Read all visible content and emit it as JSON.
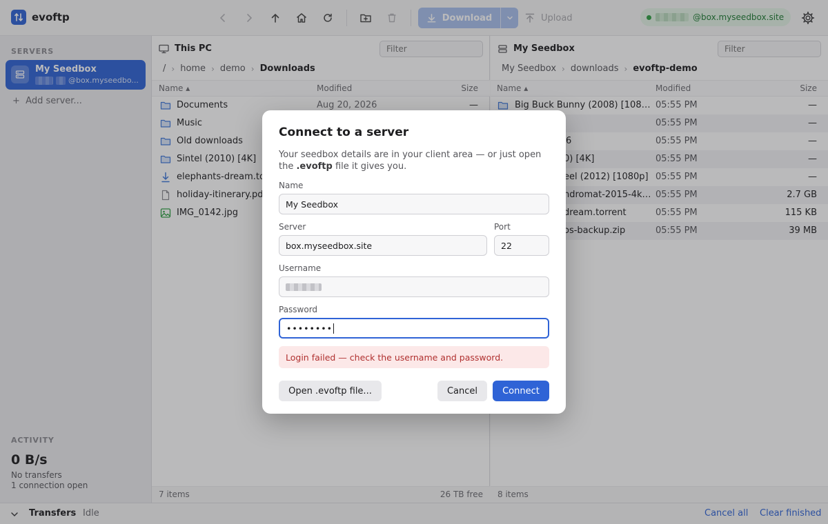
{
  "app": {
    "name": "evoftp"
  },
  "toolbar": {
    "download_label": "Download",
    "upload_label": "Upload",
    "connection_host": "@box.myseedbox.site",
    "connection_status_color": "#2ea043"
  },
  "sidebar": {
    "servers_title": "SERVERS",
    "server": {
      "name": "My Seedbox",
      "host": "@box.myseedbo..."
    },
    "add_server": "Add server...",
    "activity_title": "ACTIVITY",
    "speed": "0 B/s",
    "transfers_status": "No transfers",
    "connections": "1 connection open"
  },
  "local": {
    "title": "This PC",
    "filter_placeholder": "Filter",
    "crumbs": [
      "/",
      "home",
      "demo",
      "Downloads"
    ],
    "columns": {
      "name": "Name ▴",
      "modified": "Modified",
      "size": "Size"
    },
    "rows": [
      {
        "icon": "folder-icon",
        "name": "Documents",
        "modified": "Aug 20, 2026",
        "size": "—"
      },
      {
        "icon": "folder-icon",
        "name": "Music",
        "modified": "",
        "size": ""
      },
      {
        "icon": "folder-icon",
        "name": "Old downloads",
        "modified": "",
        "size": ""
      },
      {
        "icon": "folder-icon",
        "name": "Sintel (2010) [4K]",
        "modified": "",
        "size": ""
      },
      {
        "icon": "torrent-download-icon",
        "name": "elephants-dream.to",
        "modified": "",
        "size": ""
      },
      {
        "icon": "document-icon",
        "name": "holiday-itinerary.pd",
        "modified": "",
        "size": ""
      },
      {
        "icon": "image-icon",
        "name": "IMG_0142.jpg",
        "modified": "",
        "size": ""
      }
    ],
    "status_items": "7 items",
    "status_free": "26 TB free"
  },
  "remote": {
    "title": "My Seedbox",
    "filter_placeholder": "Filter",
    "crumbs": [
      "My Seedbox",
      "downloads",
      "evoftp-demo"
    ],
    "columns": {
      "name": "Name ▴",
      "modified": "Modified",
      "size": "Size"
    },
    "rows": [
      {
        "name": "Big Buck Bunny (2008) [108…",
        "modified": "05:55 PM",
        "size": "—"
      },
      {
        "name": "",
        "modified": "05:55 PM",
        "size": "—"
      },
      {
        "name": "6",
        "modified": "05:55 PM",
        "size": "—"
      },
      {
        "name": "0) [4K]",
        "modified": "05:55 PM",
        "size": "—"
      },
      {
        "name": "eel (2012) [1080p]",
        "modified": "05:55 PM",
        "size": "—"
      },
      {
        "name": "ndromat-2015-4k…",
        "modified": "05:55 PM",
        "size": "2.7 GB"
      },
      {
        "name": "dream.torrent",
        "modified": "05:55 PM",
        "size": "115 KB"
      },
      {
        "name": "os-backup.zip",
        "modified": "05:55 PM",
        "size": "39 MB"
      }
    ],
    "status_items": "8 items"
  },
  "transfers": {
    "title": "Transfers",
    "state": "Idle",
    "cancel_all": "Cancel all",
    "clear_finished": "Clear finished"
  },
  "dialog": {
    "title": "Connect to a server",
    "desc_before": "Your seedbox details are in your client area — or just open the ",
    "desc_file": ".evoftp",
    "desc_after": " file it gives you.",
    "name_label": "Name",
    "name_value": "My Seedbox",
    "server_label": "Server",
    "server_value": "box.myseedbox.site",
    "port_label": "Port",
    "port_value": "22",
    "username_label": "Username",
    "password_label": "Password",
    "password_value": "••••••••",
    "error": "Login failed — check the username and password.",
    "open_file_button": "Open .evoftp file...",
    "cancel_button": "Cancel",
    "connect_button": "Connect"
  }
}
